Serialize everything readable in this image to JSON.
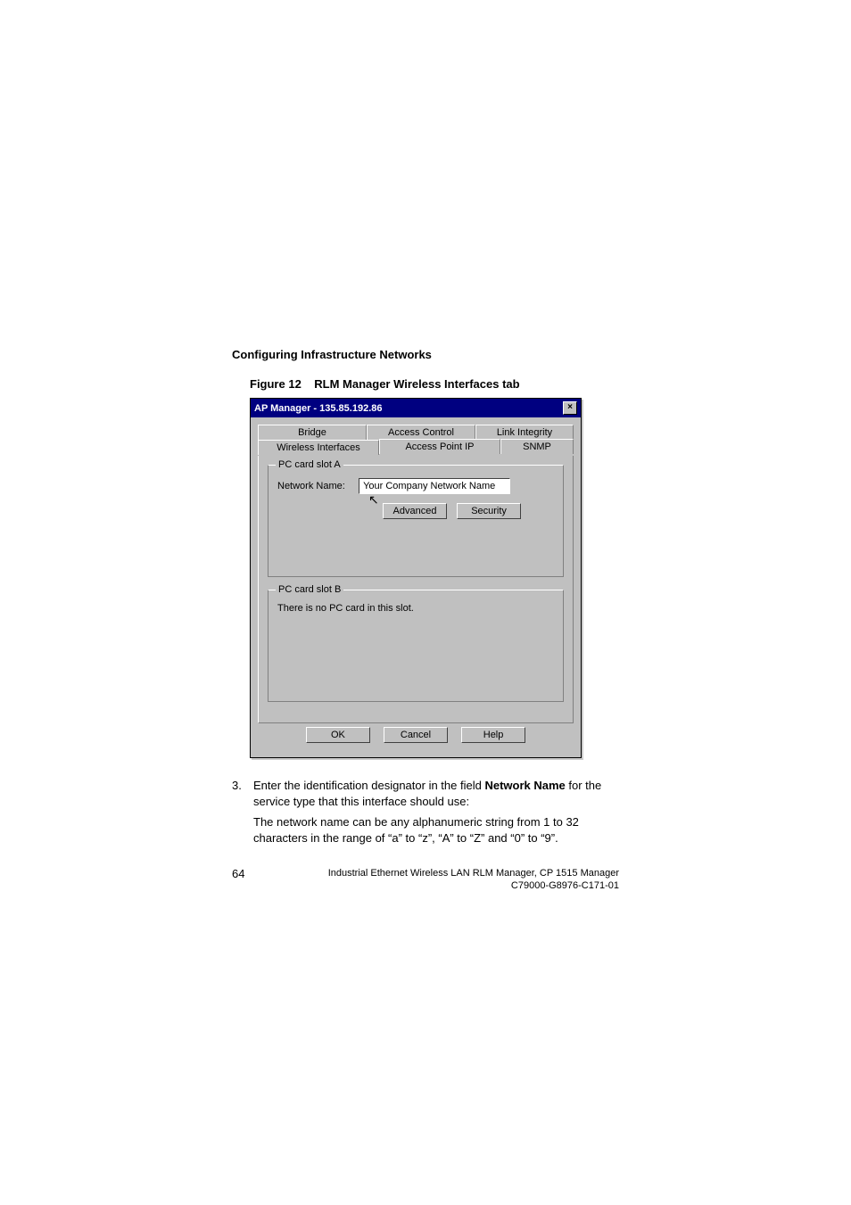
{
  "header": "Configuring Infrastructure Networks",
  "figure": {
    "label": "Figure 12",
    "caption": "RLM Manager Wireless Interfaces tab"
  },
  "dialog": {
    "title": "AP Manager - 135.85.192.86",
    "close_glyph": "×",
    "tabs_back": [
      "Bridge",
      "Access Control",
      "Link Integrity"
    ],
    "tabs_front": [
      "Wireless Interfaces",
      "Access Point IP",
      "SNMP"
    ],
    "groupA": {
      "title": "PC card slot A",
      "network_name_label": "Network Name:",
      "network_name_value": "Your Company Network Name",
      "btn_advanced": "Advanced",
      "btn_security": "Security"
    },
    "groupB": {
      "title": "PC card slot B",
      "message": "There is no PC card in this slot."
    },
    "btn_ok": "OK",
    "btn_cancel": "Cancel",
    "btn_help": "Help"
  },
  "step": {
    "num": "3.",
    "text_before_bold": "Enter the identification designator in the field ",
    "bold": "Network Name",
    "text_after_bold": " for the service type that this interface should use:"
  },
  "para": "The network name can be any alphanumeric string from 1 to 32 characters in the range of “a” to “z”, “A” to “Z” and “0” to “9”.",
  "footer": {
    "page": "64",
    "line1": "Industrial Ethernet Wireless LAN  RLM Manager,  CP 1515 Manager",
    "line2": "C79000-G8976-C171-01"
  }
}
